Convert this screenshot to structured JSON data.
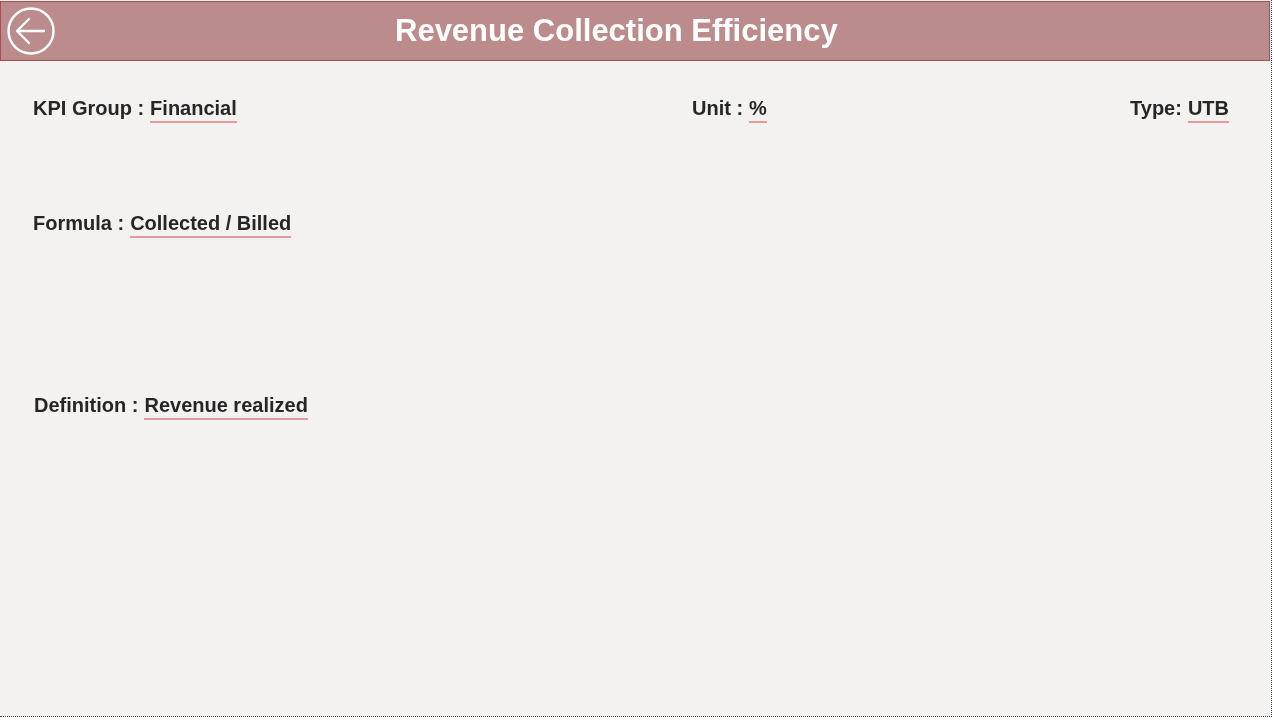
{
  "header": {
    "title": "Revenue Collection Efficiency"
  },
  "rows": [
    {
      "fields": [
        {
          "label": "KPI Group :",
          "value": "Financial"
        },
        {
          "label": "Unit :",
          "value": "%"
        },
        {
          "label": "Type:",
          "value": "UTB"
        }
      ]
    },
    {
      "fields": [
        {
          "label": "Formula :",
          "value": "Collected / Billed"
        }
      ]
    },
    {
      "fields": [
        {
          "label": "Definition :",
          "value": "Revenue realized"
        }
      ]
    }
  ]
}
